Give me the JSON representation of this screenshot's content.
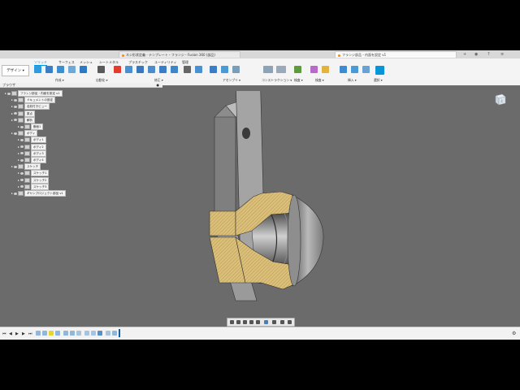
{
  "window": {
    "tabs": [
      {
        "label": "ネジ形状定義 - テンプレート・フランジ・Fusion 360 (部品)",
        "active": false
      },
      {
        "label": "フランジ部品・内面を設定 v1",
        "active": true
      }
    ],
    "controls": [
      "+",
      "◉",
      "?",
      "≡"
    ]
  },
  "ribbon": {
    "workspace": "デザイン ▾",
    "tabs": [
      "ソリッド",
      "サーフェス",
      "メッシュ",
      "シートメタル",
      "プラスチック",
      "ユーティリティ",
      "管理"
    ],
    "active_tab": "ソリッド",
    "groups": [
      "作成 ▾",
      "自動化 ▾",
      "修正 ▾",
      "アセンブリ ▾",
      "コンストラクション ▾",
      "検査 ▾",
      "挿入 ▾",
      "選択 ▾"
    ]
  },
  "browser": {
    "header": "ブラウザ",
    "nodes": [
      {
        "label": "フランジ部品・内面を設定 v1",
        "level": 0
      },
      {
        "label": "ドキュメントの設定",
        "level": 1
      },
      {
        "label": "名前付きビュー",
        "level": 1
      },
      {
        "label": "原点",
        "level": 1
      },
      {
        "label": "解析",
        "level": 1
      },
      {
        "label": "断面1",
        "level": 2
      },
      {
        "label": "ボディ",
        "level": 1
      },
      {
        "label": "ボディ1",
        "level": 2
      },
      {
        "label": "ボディ2",
        "level": 2
      },
      {
        "label": "ボディ3",
        "level": 2
      },
      {
        "label": "ボディ4",
        "level": 2
      },
      {
        "label": "スケッチ",
        "level": 1
      },
      {
        "label": "スケッチ1",
        "level": 2
      },
      {
        "label": "スケッチ2",
        "level": 2
      },
      {
        "label": "スケッチ3",
        "level": 2
      },
      {
        "label": "ギヤンプロジェクト部品 v1",
        "level": 1
      }
    ]
  },
  "viewcube": {
    "label": "上"
  },
  "colors": {
    "viewport": "#6b6b6b",
    "accent": "#0696d7",
    "section_hatch": "#dcc07a",
    "part_metal": "#9a9a9a"
  }
}
